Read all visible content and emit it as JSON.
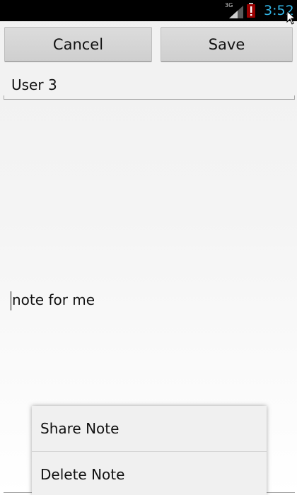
{
  "status_bar": {
    "network_label": "3G",
    "time": "3:52",
    "battery_state": "low",
    "accent_color": "#33b5e5"
  },
  "actions": {
    "cancel_label": "Cancel",
    "save_label": "Save"
  },
  "note": {
    "title": "User 3",
    "body": "note for me"
  },
  "context_menu": {
    "items": [
      {
        "label": "Share Note"
      },
      {
        "label": "Delete Note"
      }
    ]
  },
  "icons": {
    "signal": "signal-icon",
    "battery": "battery-alert-icon",
    "cursor": "mouse-cursor-icon"
  }
}
